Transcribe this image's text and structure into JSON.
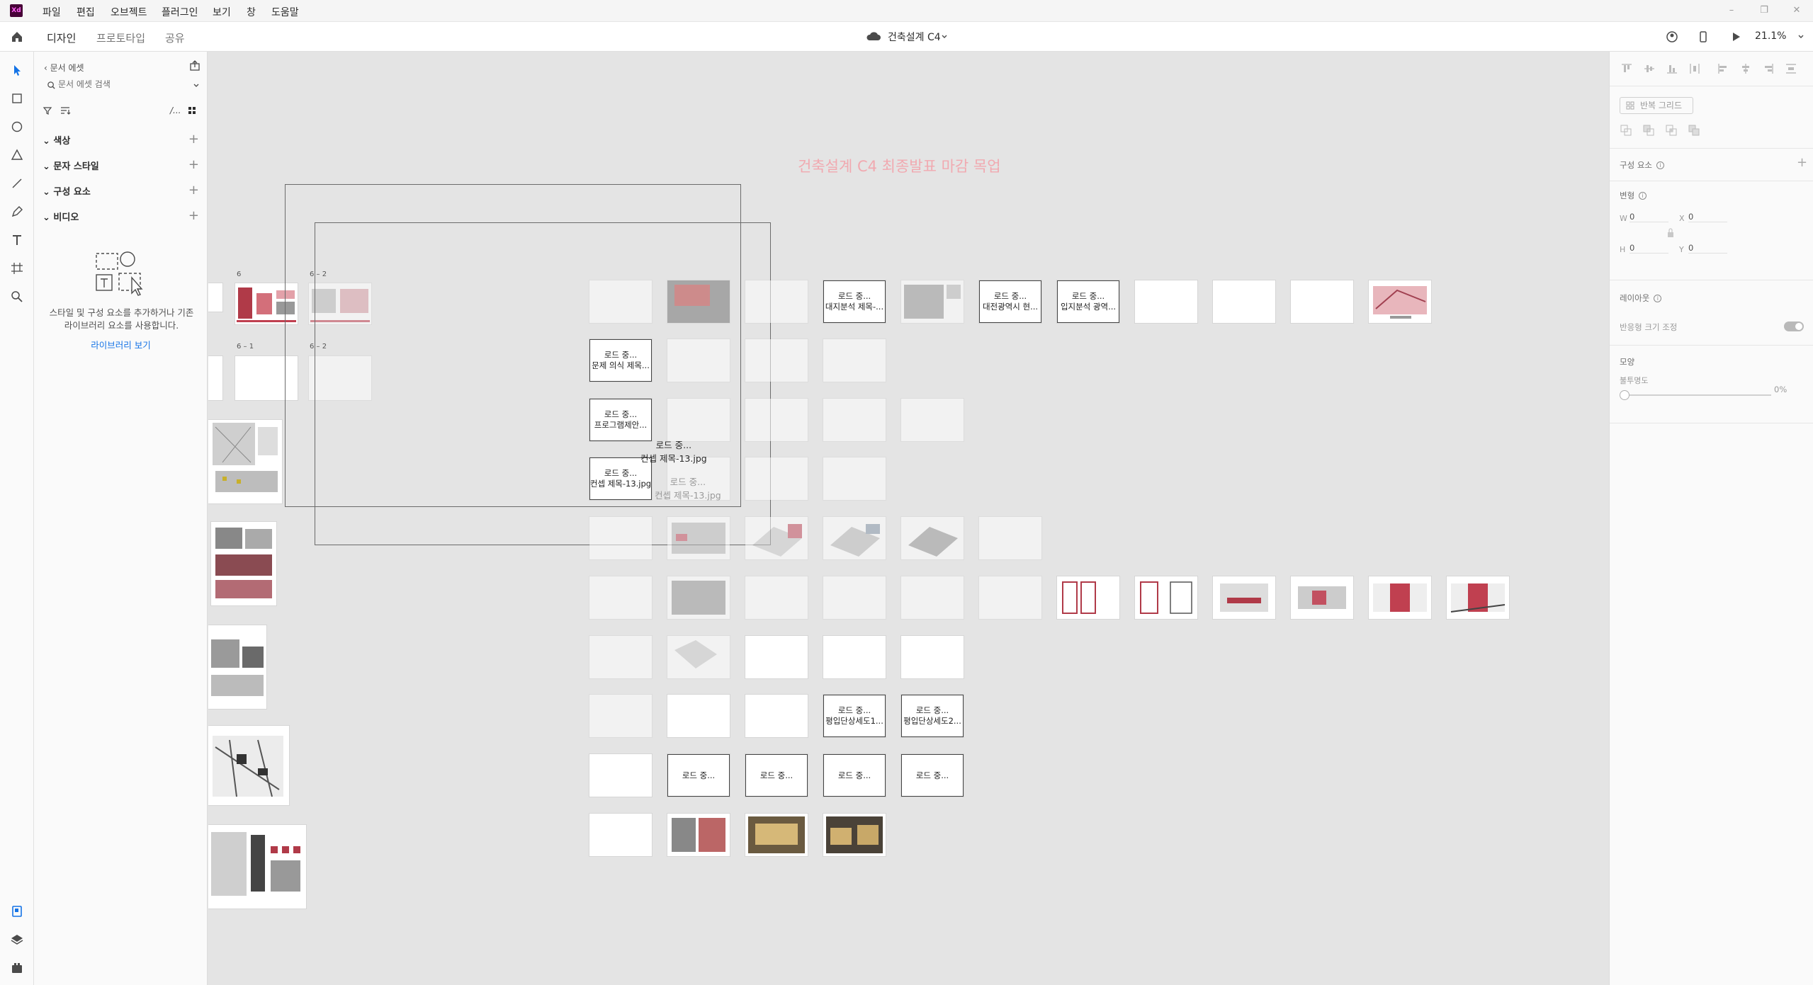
{
  "app": {
    "logo_text": "Xd",
    "menu": [
      "파일",
      "편집",
      "오브젝트",
      "플러그인",
      "보기",
      "창",
      "도움말"
    ]
  },
  "header": {
    "tabs": [
      {
        "label": "디자인",
        "active": true
      },
      {
        "label": "프로토타입",
        "active": false
      },
      {
        "label": "공유",
        "active": false
      }
    ],
    "document_title": "건축설계 C4",
    "zoom": "21.1%"
  },
  "assets_panel": {
    "back_label": "문서 에셋",
    "search_placeholder": "문서 에셋 검색",
    "filter_divider": "/...",
    "sections": [
      {
        "label": "색상"
      },
      {
        "label": "문자 스타일"
      },
      {
        "label": "구성 요소"
      },
      {
        "label": "비디오"
      }
    ],
    "empty_message": "스타일 및 구성 요소를 추가하거나 기존 라이브러리 요소를 사용합니다.",
    "library_link": "라이브러리 보기"
  },
  "canvas": {
    "title": "건축설계 C4 최종발표 마감 목업",
    "artboard_labels": {
      "a6": "6",
      "a6_2": "6 – 2",
      "a6_1": "6 – 1",
      "a6_2b": "6 – 2"
    },
    "loading": {
      "row1_c4": [
        "로드 중...",
        "대지분석 제목-..."
      ],
      "row1_c6": [
        "로드 중...",
        "대전광역시 현..."
      ],
      "row1_c7": [
        "로드 중...",
        "입지분석 광역..."
      ],
      "row2_c1": [
        "로드 중...",
        "문제 의식 제목..."
      ],
      "row3_c1": [
        "로드 중...",
        "프로그램제안..."
      ],
      "row4_c1": [
        "로드 중...",
        "컨셉 제목-13.jpg"
      ],
      "floating_1": [
        "로드 중...",
        "컨셉 제목-13.jpg"
      ],
      "floating_2": [
        "로드 중...",
        "컨셉 제목-13.jpg"
      ],
      "row8_c4": [
        "로드 중...",
        "평입단상세도1..."
      ],
      "row8_c5": [
        "로드 중...",
        "평입단상세도2..."
      ],
      "row9_c2": "로드 중...",
      "row9_c3": "로드 중...",
      "row9_c4": "로드 중...",
      "row9_c5": "로드 중..."
    }
  },
  "props_panel": {
    "repeat_grid": "반복 그리드",
    "components_label": "구성 요소",
    "transform_label": "변형",
    "w_label": "W",
    "w_value": "0",
    "h_label": "H",
    "h_value": "0",
    "x_label": "X",
    "x_value": "0",
    "y_label": "Y",
    "y_value": "0",
    "layout_label": "레이아웃",
    "responsive_label": "반응형 크기 조정",
    "appearance_label": "모양",
    "opacity_label": "불투명도",
    "opacity_value": "0%"
  },
  "colors": {
    "accent": "#1473e6",
    "brand": "#470137",
    "title_pink": "#f1a9b0"
  }
}
